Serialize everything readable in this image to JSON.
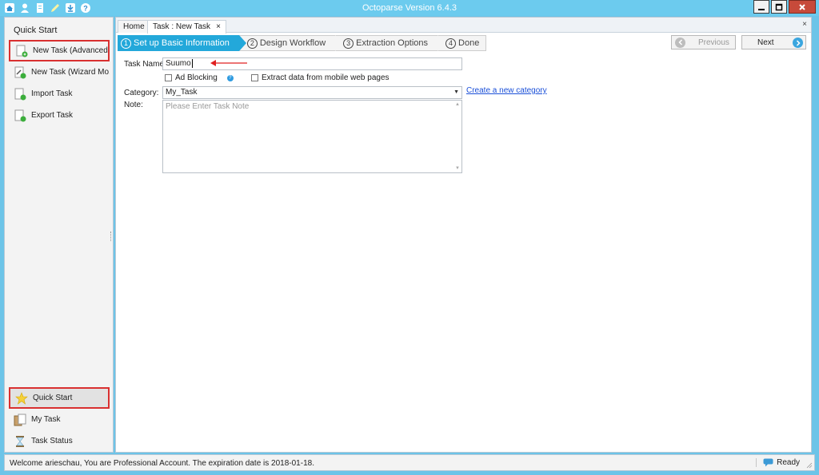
{
  "window": {
    "title": "Octoparse Version 6.4.3",
    "controls": [
      "minimize",
      "maximize",
      "close"
    ]
  },
  "toolbar_icons": [
    "home-icon",
    "user-icon",
    "document-icon",
    "pencil-icon",
    "download-icon",
    "help-icon"
  ],
  "sidebar": {
    "header": "Quick Start",
    "items": [
      {
        "label": "New Task (Advanced...",
        "icon": "new-task-icon",
        "highlighted": true
      },
      {
        "label": "New Task (Wizard Mo...",
        "icon": "wizard-icon",
        "highlighted": false
      },
      {
        "label": "Import Task",
        "icon": "import-icon",
        "highlighted": false
      },
      {
        "label": "Export Task",
        "icon": "export-icon",
        "highlighted": false
      }
    ],
    "bottom_items": [
      {
        "label": "Quick Start",
        "icon": "star-icon",
        "highlighted": true,
        "selected": true
      },
      {
        "label": "My Task",
        "icon": "my-task-icon",
        "highlighted": false
      },
      {
        "label": "Task Status",
        "icon": "hourglass-icon",
        "highlighted": false
      }
    ]
  },
  "tabs": [
    {
      "label": "Home",
      "active": false
    },
    {
      "label": "Task : New Task",
      "active": true,
      "closable": true
    }
  ],
  "close_label": "×",
  "steps": [
    {
      "num": "1",
      "label": "Set up Basic Information",
      "active": true
    },
    {
      "num": "2",
      "label": "Design Workflow",
      "active": false
    },
    {
      "num": "3",
      "label": "Extraction Options",
      "active": false
    },
    {
      "num": "4",
      "label": "Done",
      "active": false
    }
  ],
  "nav": {
    "previous": "Previous",
    "next": "Next",
    "previous_enabled": false
  },
  "form": {
    "task_name_label": "Task Name:",
    "task_name_value": "Suumo",
    "ad_blocking_label": "Ad Blocking",
    "ad_blocking_checked": false,
    "mobile_label": "Extract data from mobile web pages",
    "mobile_checked": false,
    "category_label": "Category:",
    "category_value": "My_Task",
    "create_category_link": "Create a new category",
    "note_label": "Note:",
    "note_placeholder": "Please Enter Task Note"
  },
  "status": {
    "message": "Welcome arieschau, You are Professional Account. The expiration date is 2018-01-18.",
    "state": "Ready"
  },
  "colors": {
    "title_bar": "#6ccbee",
    "step_active": "#23a8da",
    "highlight_border": "#d93030",
    "annotation_arrow": "#e02020",
    "link": "#1a4fd8"
  }
}
